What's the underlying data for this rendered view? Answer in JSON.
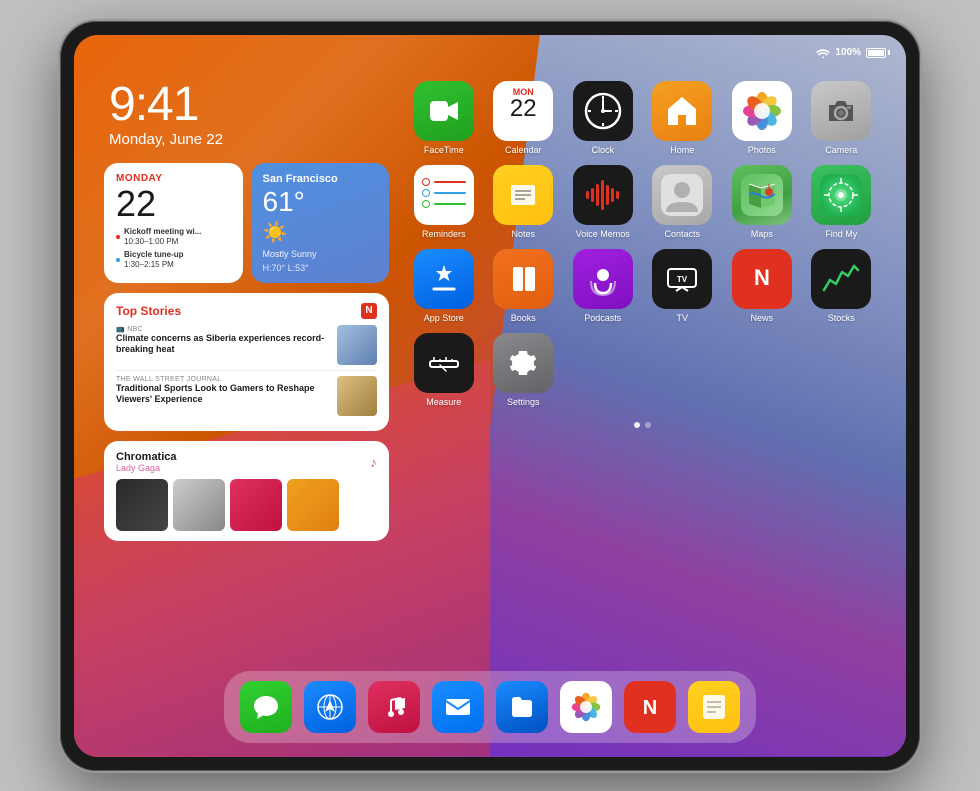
{
  "device": {
    "model": "iPad Pro"
  },
  "statusBar": {
    "wifi_icon": "wifi",
    "battery_percent": "100%",
    "battery_label": "100%"
  },
  "time": {
    "display": "9:41",
    "date": "Monday, June 22"
  },
  "widgets": {
    "calendar": {
      "day_name": "MONDAY",
      "day_number": "22",
      "event1_title": "Kickoff meeting wi...",
      "event1_time": "10:30–1:00 PM",
      "event2_title": "Bicycle tune-up",
      "event2_time": "1:30–2:15 PM"
    },
    "weather": {
      "city": "San Francisco",
      "temp": "61°",
      "condition": "Mostly Sunny",
      "hi": "H:70°",
      "lo": "L:53°"
    },
    "news": {
      "title": "Top Stories",
      "item1_source": "NBC",
      "item1_headline": "Climate concerns as Siberia experiences record-breaking heat",
      "item2_source": "THE WALL STREET JOURNAL",
      "item2_headline": "Traditional Sports Look to Gamers to Reshape Viewers' Experience"
    },
    "music": {
      "title": "Chromatica",
      "artist": "Lady Gaga"
    }
  },
  "apps": {
    "row1": [
      {
        "name": "FaceTime",
        "icon": "facetime"
      },
      {
        "name": "Calendar",
        "icon": "calendar"
      },
      {
        "name": "Clock",
        "icon": "clock"
      },
      {
        "name": "Home",
        "icon": "home"
      },
      {
        "name": "Photos",
        "icon": "photos"
      },
      {
        "name": "Camera",
        "icon": "camera"
      }
    ],
    "row2": [
      {
        "name": "Reminders",
        "icon": "reminders"
      },
      {
        "name": "Notes",
        "icon": "notes"
      },
      {
        "name": "Voice Memos",
        "icon": "voicememos"
      },
      {
        "name": "Contacts",
        "icon": "contacts"
      },
      {
        "name": "Maps",
        "icon": "maps"
      },
      {
        "name": "Find My",
        "icon": "findmy"
      }
    ],
    "row3": [
      {
        "name": "App Store",
        "icon": "appstore"
      },
      {
        "name": "Books",
        "icon": "books"
      },
      {
        "name": "Podcasts",
        "icon": "podcasts"
      },
      {
        "name": "TV",
        "icon": "tv"
      },
      {
        "name": "News",
        "icon": "news"
      },
      {
        "name": "Stocks",
        "icon": "stocks"
      }
    ],
    "row4": [
      {
        "name": "Measure",
        "icon": "measure"
      },
      {
        "name": "Settings",
        "icon": "settings"
      }
    ]
  },
  "dock": {
    "items": [
      {
        "name": "Messages",
        "icon": "messages"
      },
      {
        "name": "Safari",
        "icon": "safari"
      },
      {
        "name": "Music",
        "icon": "music"
      },
      {
        "name": "Mail",
        "icon": "mail"
      },
      {
        "name": "Files",
        "icon": "files"
      },
      {
        "name": "Photos",
        "icon": "photos"
      },
      {
        "name": "News",
        "icon": "news"
      },
      {
        "name": "Notes",
        "icon": "notes"
      }
    ]
  },
  "pageDots": {
    "total": 2,
    "active": 0
  }
}
